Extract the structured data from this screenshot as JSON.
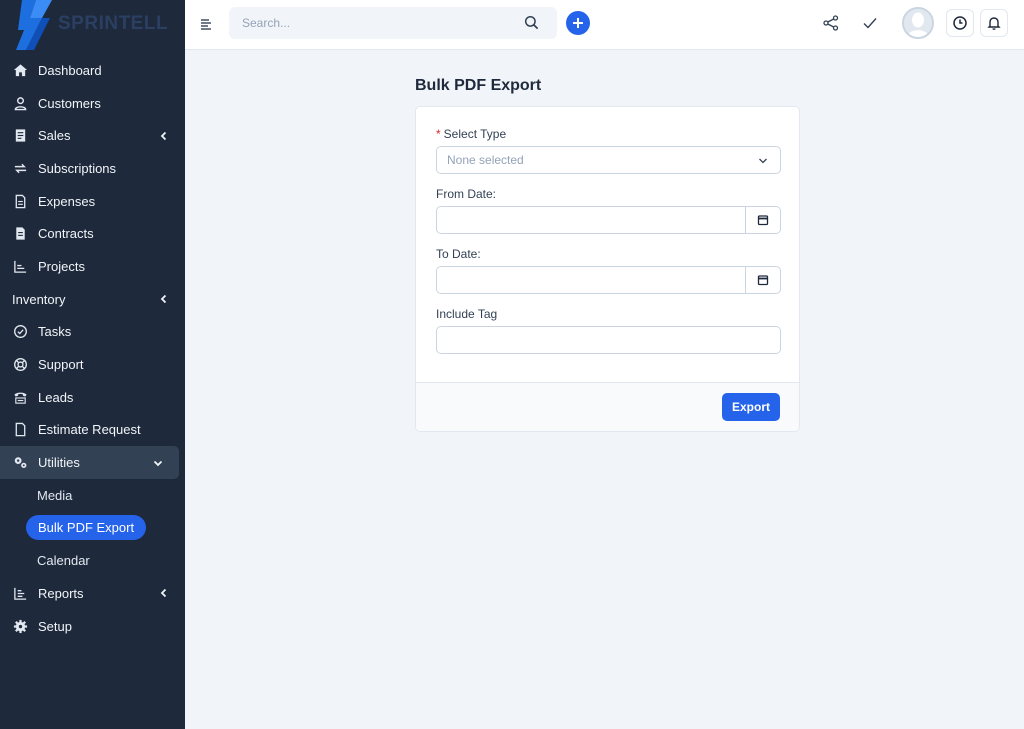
{
  "brand": {
    "name": "SPRINTELL",
    "accent": "#2563eb"
  },
  "sidebar": {
    "items": [
      {
        "label": "Dashboard",
        "icon": "home-icon"
      },
      {
        "label": "Customers",
        "icon": "user-icon"
      },
      {
        "label": "Sales",
        "icon": "receipt-icon",
        "expandable": true
      },
      {
        "label": "Subscriptions",
        "icon": "repeat-icon"
      },
      {
        "label": "Expenses",
        "icon": "file-text-icon"
      },
      {
        "label": "Contracts",
        "icon": "contract-icon"
      },
      {
        "label": "Projects",
        "icon": "chart-icon"
      },
      {
        "label": "Inventory",
        "icon": "",
        "expandable": true
      },
      {
        "label": "Tasks",
        "icon": "check-circle-icon"
      },
      {
        "label": "Support",
        "icon": "lifebuoy-icon"
      },
      {
        "label": "Leads",
        "icon": "tty-icon"
      },
      {
        "label": "Estimate Request",
        "icon": "document-icon"
      },
      {
        "label": "Utilities",
        "icon": "cogs-icon",
        "expanded": true
      },
      {
        "label": "Reports",
        "icon": "bar-chart-icon",
        "expandable": true
      },
      {
        "label": "Setup",
        "icon": "gear-icon"
      }
    ],
    "utilities_sub": [
      "Media",
      "Bulk PDF Export",
      "Calendar"
    ],
    "active_sub": "Bulk PDF Export"
  },
  "topbar": {
    "search_placeholder": "Search..."
  },
  "page": {
    "title": "Bulk PDF Export",
    "form": {
      "select_type_label": "Select Type",
      "select_type_value": "None selected",
      "from_date_label": "From Date:",
      "from_date_value": "",
      "to_date_label": "To Date:",
      "to_date_value": "",
      "include_tag_label": "Include Tag",
      "include_tag_value": ""
    },
    "export_label": "Export"
  }
}
